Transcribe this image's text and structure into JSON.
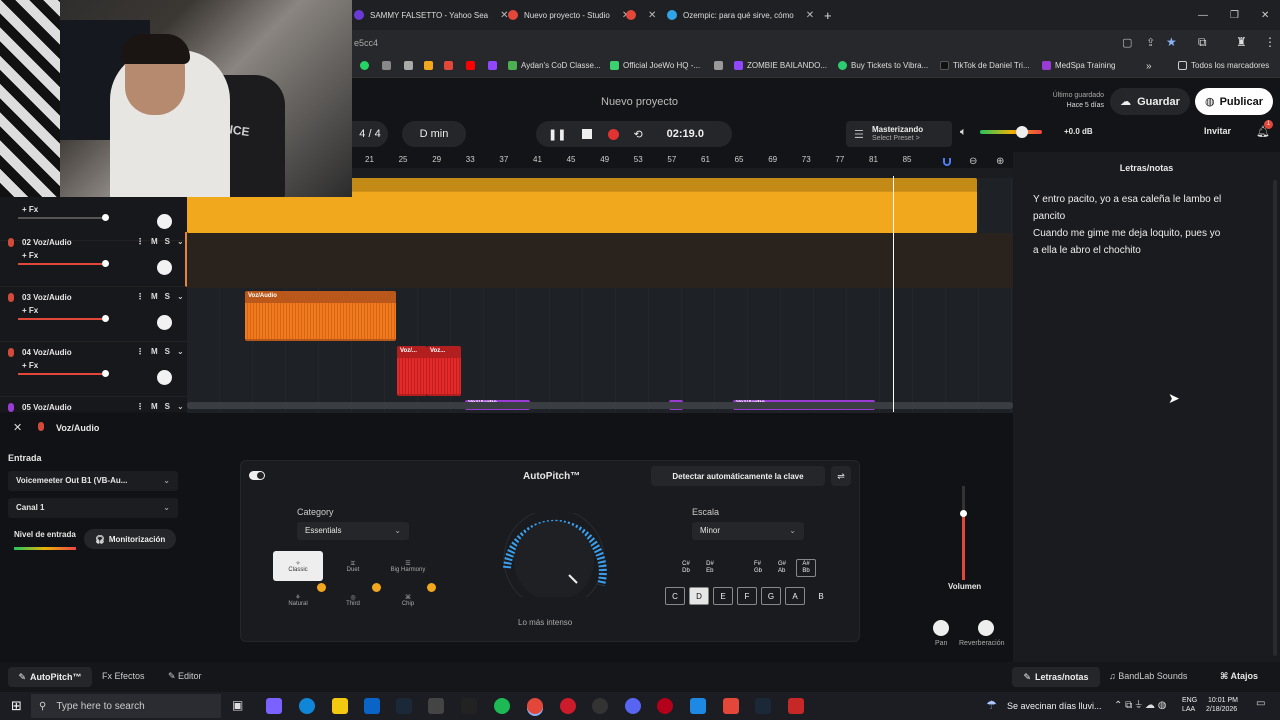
{
  "browser": {
    "tabs": [
      {
        "label": "SAMMY FALSETTO - Yahoo Sea",
        "color": "#6b3ad6"
      },
      {
        "label": "Nuevo proyecto - Studio",
        "color": "#e2473a"
      },
      {
        "label": "",
        "color": "#e2473a"
      },
      {
        "label": "Ozempic: para qué sirve, cómo",
        "color": "#2fa4e7"
      }
    ],
    "url_fragment": "e5cc4",
    "bookmarks": [
      {
        "label": "Aydan's CoD Classe..."
      },
      {
        "label": "Official JoeWo HQ -..."
      },
      {
        "label": "ZOMBIE BAILANDO..."
      },
      {
        "label": "Buy Tickets to Vibra..."
      },
      {
        "label": "TikTok de Daniel Tri..."
      },
      {
        "label": "MedSpa Training"
      },
      {
        "label": "Todos los marcadores"
      }
    ]
  },
  "header": {
    "project_title": "Nuevo proyecto",
    "last_saved_label": "Último guardado",
    "last_saved_value": "Hace 5 días",
    "save_button": "Guardar",
    "publish_button": "Publicar",
    "invite_button": "Invitar",
    "notif_count": "1"
  },
  "transport": {
    "time_signature": "4 / 4",
    "key": "D min",
    "time": "02:19.0",
    "mastering_title": "Masterizando",
    "mastering_sub": "Select Preset >",
    "volume_db": "+0.0 dB"
  },
  "ruler": [
    "21",
    "25",
    "29",
    "33",
    "37",
    "41",
    "45",
    "49",
    "53",
    "57",
    "61",
    "65",
    "69",
    "73",
    "77",
    "81",
    "85"
  ],
  "tracks": [
    {
      "number": "",
      "name": "",
      "fx": "+ Fx"
    },
    {
      "number": "02",
      "name": "Voz/Audio",
      "fx": "+ Fx"
    },
    {
      "number": "03",
      "name": "Voz/Audio",
      "fx": "+ Fx"
    },
    {
      "number": "04",
      "name": "Voz/Audio",
      "fx": "+ Fx"
    },
    {
      "number": "05",
      "name": "Voz/Audio",
      "fx": ""
    }
  ],
  "clips": {
    "track3": "Voz/Audio",
    "track4a": "Voz/...",
    "track4b": "Voz...",
    "track5a": "Voz/Audio",
    "track5b": "Voz/Audio"
  },
  "lyrics": {
    "title": "Letras/notas",
    "lines": [
      "Y entro pacito, yo a esa caleña le lambo el",
      "pancito",
      "Cuando me gime me deja loquito, pues yo",
      "a ella le abro el chochito"
    ]
  },
  "inspector": {
    "track_name": "Voz/Audio",
    "input_label": "Entrada",
    "input_device": "Voicemeeter Out B1 (VB-Au...",
    "channel": "Canal 1",
    "input_level_label": "Nivel de entrada",
    "monitoring": "Monitorización"
  },
  "autopitch": {
    "title": "AutoPitch™",
    "detect_key": "Detectar automáticamente la clave",
    "category_label": "Category",
    "category_value": "Essentials",
    "presets": [
      "Classic",
      "Duet",
      "Big Harmony",
      "Natural",
      "Third",
      "Chip"
    ],
    "knob_label": "Lo más intenso",
    "scale_label": "Escala",
    "scale_value": "Minor",
    "sharp_keys": [
      "C#\nDb",
      "D#\nEb",
      "F#\nGb",
      "G#\nAb",
      "A#\nBb"
    ],
    "natural_keys": [
      "C",
      "D",
      "E",
      "F",
      "G",
      "A",
      "B"
    ],
    "volume_label": "Volumen",
    "pan_label": "Pan",
    "reverb_label": "Reverberación"
  },
  "footer": {
    "autopitch": "AutoPitch™",
    "effects": "Efectos",
    "editor": "Editor",
    "lyrics": "Letras/notas",
    "sounds": "BandLab Sounds",
    "shortcuts": "Atajos"
  },
  "taskbar": {
    "search_placeholder": "Type here to search",
    "weather": "Se avecinan días lluvi...",
    "lang": "ENG",
    "region": "LAA",
    "time": "10:01 PM",
    "date": "2/18/2026"
  },
  "colors": {
    "accent_orange": "#f2a81d",
    "clip_orange": "#f07a1e",
    "clip_red": "#e32a2a",
    "clip_purple": "#9b3bd6",
    "record_red": "#e23232"
  }
}
